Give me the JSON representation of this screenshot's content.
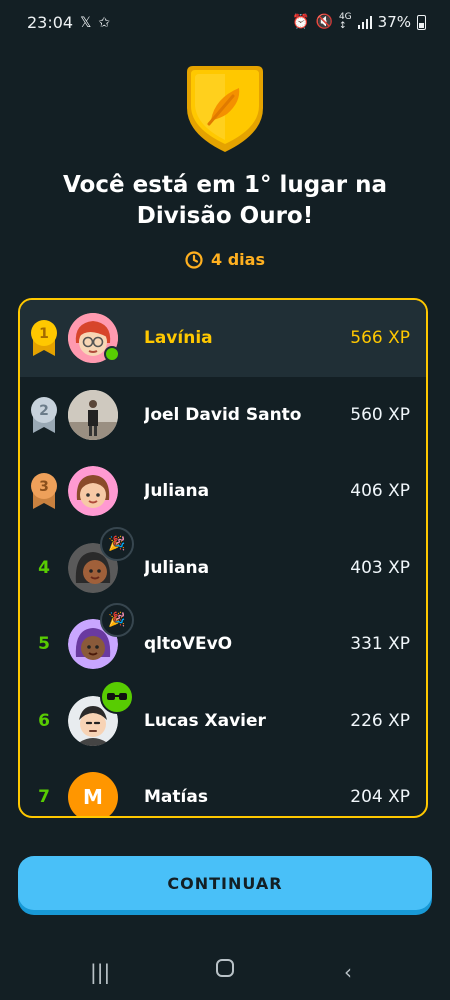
{
  "status_bar": {
    "time": "23:04",
    "battery": "37%",
    "icons": [
      "x-app-icon",
      "star-icon",
      "alarm-icon",
      "mute-icon",
      "4g-icon",
      "signal-icon",
      "battery-icon"
    ]
  },
  "header": {
    "badge_icon": "gold-league-badge-feather",
    "title": "Você está em 1° lugar na Divisão Ouro!",
    "days": "4 dias"
  },
  "leaderboard": {
    "rows": [
      {
        "rank": "1",
        "name": "Lavínia",
        "xp": "566 XP"
      },
      {
        "rank": "2",
        "name": "Joel David Santo",
        "xp": "560 XP"
      },
      {
        "rank": "3",
        "name": "Juliana",
        "xp": "406 XP"
      },
      {
        "rank": "4",
        "name": "Juliana",
        "xp": "403 XP"
      },
      {
        "rank": "5",
        "name": "qltoVEvO",
        "xp": "331 XP"
      },
      {
        "rank": "6",
        "name": "Lucas Xavier",
        "xp": "226 XP"
      },
      {
        "rank": "7",
        "name": "Matías",
        "xp": "204 XP",
        "avatar_letter": "M"
      }
    ]
  },
  "continue_label": "CONTINUAR",
  "colors": {
    "background": "#131f24",
    "gold": "#ffc800",
    "rank_green": "#58cc02",
    "button": "#49c0f8"
  }
}
